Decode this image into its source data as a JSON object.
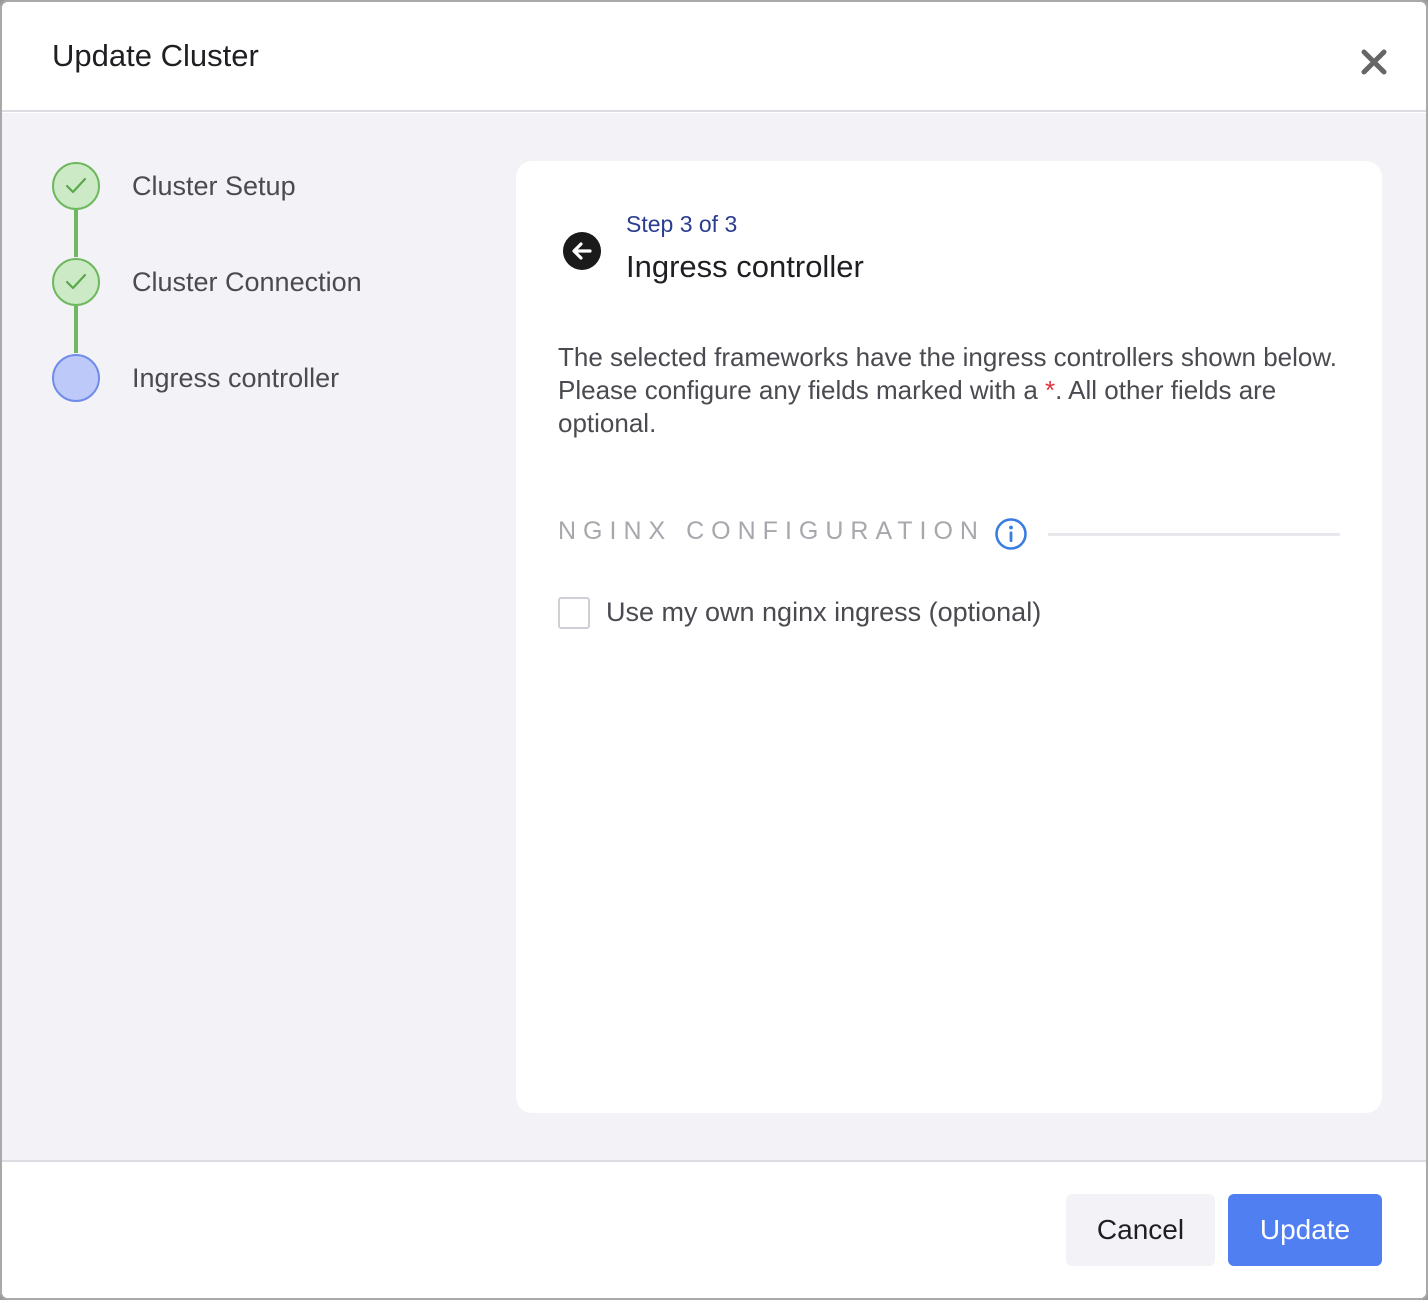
{
  "dialog": {
    "title": "Update Cluster",
    "close_icon": "close-icon"
  },
  "stepper": {
    "steps": [
      {
        "label": "Cluster Setup",
        "status": "complete"
      },
      {
        "label": "Cluster Connection",
        "status": "complete"
      },
      {
        "label": "Ingress controller",
        "status": "current"
      }
    ]
  },
  "content": {
    "step_count": "Step 3 of 3",
    "title": "Ingress controller",
    "description_part1": "The selected frameworks have the ingress controllers shown below. Please configure any fields marked with a ",
    "required_marker": "*",
    "description_part2": ". All other fields are optional.",
    "section_title": "NGINX CONFIGURATION",
    "checkbox_label": "Use my own nginx ingress (optional)",
    "checkbox_checked": false
  },
  "footer": {
    "cancel_label": "Cancel",
    "update_label": "Update"
  },
  "colors": {
    "primary": "#4f7ff1",
    "complete_green": "#6fb85f",
    "required_red": "#e2323c",
    "step_count_blue": "#2a3d8f"
  }
}
